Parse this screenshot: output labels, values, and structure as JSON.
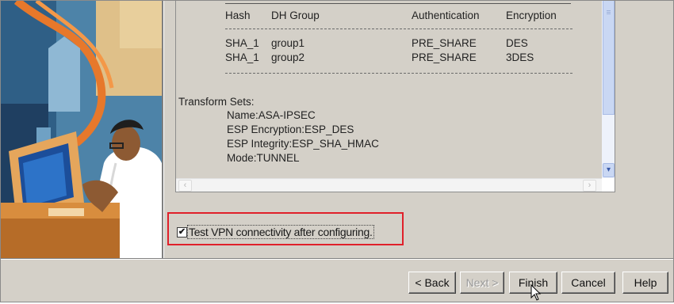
{
  "config_table": {
    "headers": [
      "Hash",
      "DH Group",
      "Authentication",
      "Encryption"
    ],
    "rows": [
      [
        "SHA_1",
        "group1",
        "PRE_SHARE",
        "DES"
      ],
      [
        "SHA_1",
        "group2",
        "PRE_SHARE",
        "3DES"
      ]
    ]
  },
  "transform_sets": {
    "heading": "Transform Sets:",
    "name": "Name:ASA-IPSEC",
    "esp_encryption": "ESP Encryption:ESP_DES",
    "esp_integrity": "ESP Integrity:ESP_SHA_HMAC",
    "mode": "Mode:TUNNEL"
  },
  "checkbox": {
    "label": "Test VPN connectivity after configuring.",
    "checked": true,
    "check_glyph": "✔",
    "highlight_color": "#e0202a"
  },
  "buttons": {
    "back": "< Back",
    "next": "Next >",
    "finish": "Finish",
    "cancel": "Cancel",
    "help": "Help"
  },
  "scroll": {
    "up_glyph": "≡",
    "down_glyph": "▾",
    "left_glyph": "‹",
    "right_glyph": "›"
  },
  "icons": {
    "illustration": "person-at-computer-illustration",
    "cursor": "mouse-pointer-icon"
  }
}
